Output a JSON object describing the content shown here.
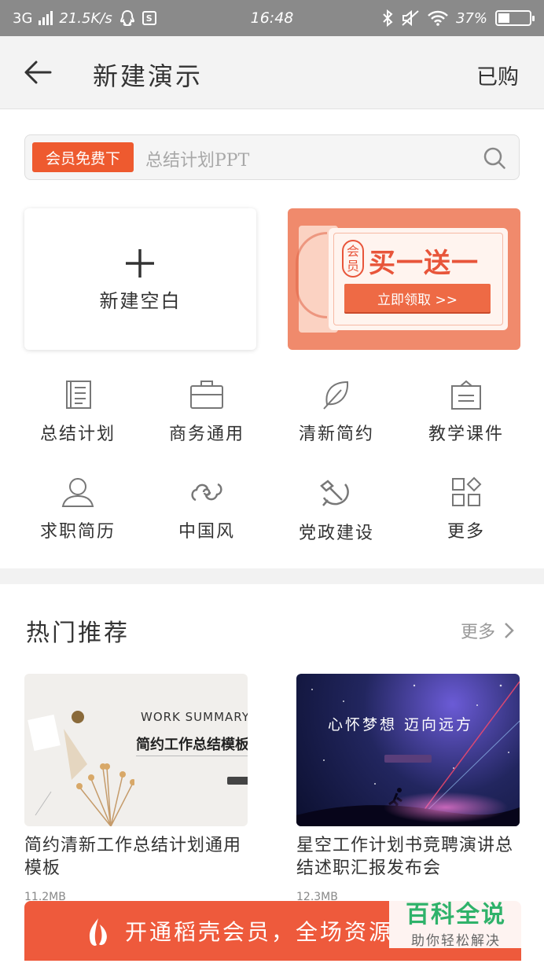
{
  "status_bar": {
    "network": "3G",
    "speed": "21.5K/s",
    "sim_icon_letter": "S",
    "time": "16:48",
    "battery": "37%",
    "battery_level": 0.37
  },
  "header": {
    "title": "新建演示",
    "purchased_label": "已购"
  },
  "search": {
    "badge": "会员免费下",
    "placeholder": "总结计划PPT"
  },
  "blank_card": {
    "label": "新建空白"
  },
  "promo": {
    "badge_top": "会",
    "badge_bottom": "员",
    "headline": "买一送一",
    "cta": "立即领取 >>",
    "accent_color": "#ee5a2f"
  },
  "categories": [
    {
      "label": "总结计划",
      "icon": "notebook-icon"
    },
    {
      "label": "商务通用",
      "icon": "briefcase-icon"
    },
    {
      "label": "清新简约",
      "icon": "leaf-icon"
    },
    {
      "label": "教学课件",
      "icon": "easel-icon"
    },
    {
      "label": "求职简历",
      "icon": "person-icon"
    },
    {
      "label": "中国风",
      "icon": "cloud-pattern-icon"
    },
    {
      "label": "党政建设",
      "icon": "hammer-sickle-icon"
    },
    {
      "label": "更多",
      "icon": "grid-more-icon"
    }
  ],
  "hot": {
    "title": "热门推荐",
    "more": "更多"
  },
  "recommendations": [
    {
      "title": "简约清新工作总结计划通用模板",
      "size": "11.2MB",
      "thumb_en": "WORK SUMMARY",
      "thumb_cn": "简约工作总结模板"
    },
    {
      "title": "星空工作计划书竞聘演讲总结述职汇报发布会",
      "size": "12.3MB",
      "thumb_cn": "心怀梦想    迈向远方"
    }
  ],
  "banner": {
    "text": "开通稻壳会员，全场资源"
  },
  "watermark": {
    "line1": "百科全说",
    "line2": "助你轻松解决"
  }
}
